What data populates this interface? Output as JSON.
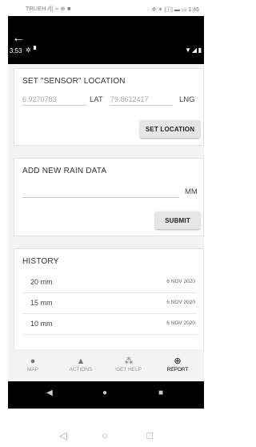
{
  "outer_status": {
    "left": "TRUEH  ⁄⁄|| ≈ ⊕ ■",
    "right": "✲ ✶ |ⓘ| ▬ ▭ 1:46"
  },
  "inner_status": {
    "time": "3:53"
  },
  "location": {
    "title": "SET \"SENSOR\" LOCATION",
    "lat_value": "6.9270783",
    "lat_label": "LAT",
    "lng_value": "79.8612417",
    "lng_label": "LNG",
    "button": "SET LOCATION"
  },
  "rain": {
    "title": "ADD NEW RAIN DATA",
    "value": "",
    "unit": "MM",
    "button": "SUBMIT"
  },
  "history": {
    "title": "HISTORY",
    "rows": [
      {
        "amount": "20 mm",
        "date": "6 NOV 2020"
      },
      {
        "amount": "15 mm",
        "date": "6 NOV 2020"
      },
      {
        "amount": "10 mm",
        "date": "6 NOV 2020"
      }
    ]
  },
  "tabs": [
    {
      "label": "MAP",
      "icon": "map-pin-icon"
    },
    {
      "label": "ACTIONS",
      "icon": "warning-icon"
    },
    {
      "label": "GET HELP",
      "icon": "signal-icon"
    },
    {
      "label": "REPORT",
      "icon": "plus-circle-icon"
    }
  ],
  "colors": {
    "app_header": "#000000",
    "app_bg": "#f3f3f3",
    "button_bg": "#e6e6e6",
    "active_tab": "#111111"
  }
}
